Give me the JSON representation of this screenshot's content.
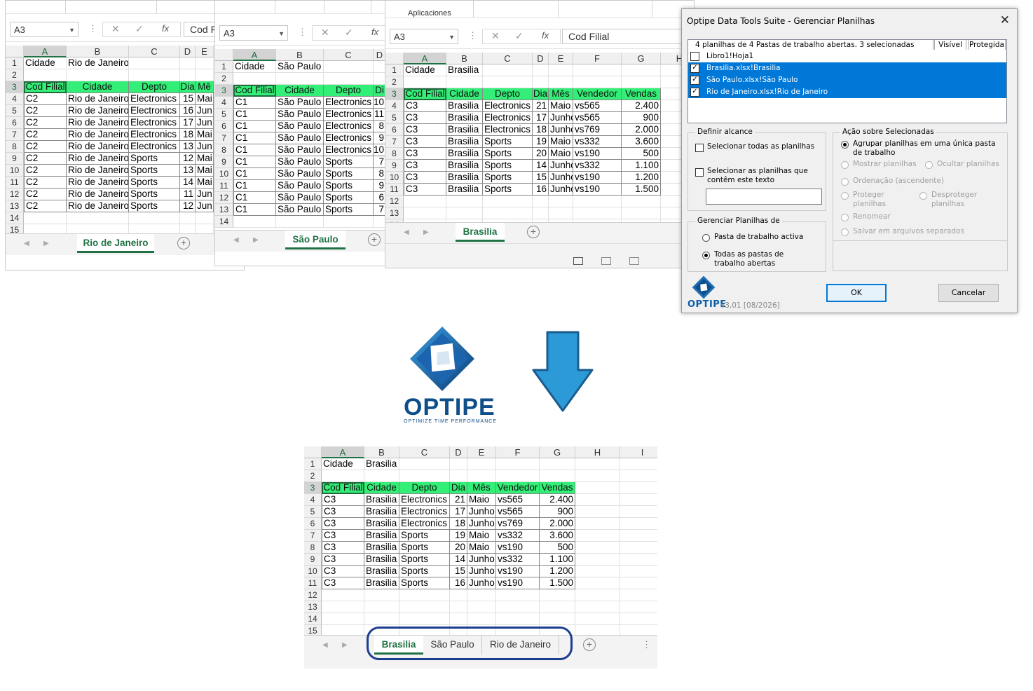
{
  "colors": {
    "header_fill": "#33ee77",
    "excel_green": "#217346",
    "select_blue": "#0078d7",
    "arrow_blue": "#2d9ad8",
    "oval_blue": "#1c3e8e"
  },
  "windows": {
    "rio": {
      "namebox": "A3",
      "formula": "Cod Fi",
      "col_headers": [
        "A",
        "B",
        "C",
        "D",
        "E"
      ],
      "rows": [
        "1",
        "2",
        "3",
        "4",
        "5",
        "6",
        "7",
        "8",
        "9",
        "10",
        "11",
        "12",
        "13",
        "14",
        "15"
      ],
      "r1": [
        "Cidade",
        "Rio de Janeiro"
      ],
      "header": [
        "Cod Filial",
        "Cidade",
        "Depto",
        "Dia",
        "Mê"
      ],
      "data": [
        [
          "C2",
          "Rio de Janeiro",
          "Electronics",
          "15",
          "Mai"
        ],
        [
          "C2",
          "Rio de Janeiro",
          "Electronics",
          "16",
          "Jun"
        ],
        [
          "C2",
          "Rio de Janeiro",
          "Electronics",
          "17",
          "Jun"
        ],
        [
          "C2",
          "Rio de Janeiro",
          "Electronics",
          "18",
          "Mai"
        ],
        [
          "C2",
          "Rio de Janeiro",
          "Electronics",
          "13",
          "Jun"
        ],
        [
          "C2",
          "Rio de Janeiro",
          "Sports",
          "12",
          "Mai"
        ],
        [
          "C2",
          "Rio de Janeiro",
          "Sports",
          "13",
          "Mai"
        ],
        [
          "C2",
          "Rio de Janeiro",
          "Sports",
          "14",
          "Mai"
        ],
        [
          "C2",
          "Rio de Janeiro",
          "Sports",
          "11",
          "Jun"
        ],
        [
          "C2",
          "Rio de Janeiro",
          "Sports",
          "12",
          "Jun"
        ]
      ],
      "tab": "Rio de Janeiro"
    },
    "sp": {
      "namebox": "A3",
      "col_headers": [
        "A",
        "B",
        "C",
        "D"
      ],
      "rows": [
        "1",
        "2",
        "3",
        "4",
        "5",
        "6",
        "7",
        "8",
        "9",
        "10",
        "11",
        "12",
        "13",
        "14"
      ],
      "r1": [
        "Cidade",
        "São Paulo"
      ],
      "header": [
        "Cod Filial",
        "Cidade",
        "Depto",
        "Di"
      ],
      "data": [
        [
          "C1",
          "São Paulo",
          "Electronics",
          "10"
        ],
        [
          "C1",
          "São Paulo",
          "Electronics",
          "11"
        ],
        [
          "C1",
          "São Paulo",
          "Electronics",
          "8"
        ],
        [
          "C1",
          "São Paulo",
          "Electronics",
          "9"
        ],
        [
          "C1",
          "São Paulo",
          "Electronics",
          "10"
        ],
        [
          "C1",
          "São Paulo",
          "Sports",
          "7"
        ],
        [
          "C1",
          "São Paulo",
          "Sports",
          "8"
        ],
        [
          "C1",
          "São Paulo",
          "Sports",
          "9"
        ],
        [
          "C1",
          "São Paulo",
          "Sports",
          "6"
        ],
        [
          "C1",
          "São Paulo",
          "Sports",
          "7"
        ]
      ],
      "tab": "São Paulo"
    },
    "bsb": {
      "ribbon_label": "Aplicaciones",
      "namebox": "A3",
      "formula": "Cod Filial",
      "col_headers": [
        "A",
        "B",
        "C",
        "D",
        "E",
        "F",
        "G",
        "H"
      ],
      "rows": [
        "1",
        "2",
        "3",
        "4",
        "5",
        "6",
        "7",
        "8",
        "9",
        "10",
        "11",
        "12",
        "13",
        "14"
      ],
      "r1": [
        "Cidade",
        "Brasilia"
      ],
      "tab": "Brasilia"
    }
  },
  "brasilia_table": {
    "header": [
      "Cod Filial",
      "Cidade",
      "Depto",
      "Dia",
      "Mês",
      "Vendedor",
      "Vendas"
    ],
    "data": [
      [
        "C3",
        "Brasilia",
        "Electronics",
        "21",
        "Maio",
        "vs565",
        "2.400"
      ],
      [
        "C3",
        "Brasilia",
        "Electronics",
        "17",
        "Junho",
        "vs565",
        "900"
      ],
      [
        "C3",
        "Brasilia",
        "Electronics",
        "18",
        "Junho",
        "vs769",
        "2.000"
      ],
      [
        "C3",
        "Brasilia",
        "Sports",
        "19",
        "Maio",
        "vs332",
        "3.600"
      ],
      [
        "C3",
        "Brasilia",
        "Sports",
        "20",
        "Maio",
        "vs190",
        "500"
      ],
      [
        "C3",
        "Brasilia",
        "Sports",
        "14",
        "Junho",
        "vs332",
        "1.100"
      ],
      [
        "C3",
        "Brasilia",
        "Sports",
        "15",
        "Junho",
        "vs190",
        "1.200"
      ],
      [
        "C3",
        "Brasilia",
        "Sports",
        "16",
        "Junho",
        "vs190",
        "1.500"
      ]
    ]
  },
  "dialog": {
    "title": "Optipe Data Tools Suite - Gerenciar Planilhas",
    "list_header": "4 planilhas de 4 Pastas de trabalho abertas.  3 selecionadas",
    "col_visible": "Visível",
    "col_protected": "Protegida",
    "items": [
      {
        "label": "Libro1!Hoja1",
        "checked": false,
        "selected": false
      },
      {
        "label": "Brasilia.xlsx!Brasilia",
        "checked": true,
        "selected": true
      },
      {
        "label": "São Paulo.xlsx!São Paulo",
        "checked": true,
        "selected": true
      },
      {
        "label": "Rio de Janeiro.xlsx!Rio de Janeiro",
        "checked": true,
        "selected": true
      }
    ],
    "scope_group": "Definir alcance",
    "scope_all": "Selecionar todas as planilhas",
    "scope_text": "Selecionar as planilhas que contêm este texto",
    "action_group": "Ação sobre Selecionadas",
    "act_group": "Agrupar planilhas em uma única pasta de trabalho",
    "act_show": "Mostrar planilhas",
    "act_hide": "Ocultar planilhas",
    "act_sort": "Ordenação (ascendente)",
    "act_protect": "Proteger planilhas",
    "act_unprotect": "Desproteger planilhas",
    "act_rename": "Renomear",
    "act_save": "Salvar em arquivos separados",
    "manage_group": "Gerenciar Planilhas de",
    "manage_active": "Pasta de trabalho activa",
    "manage_all": "Todas as pastas de trabalho abertas",
    "ok": "OK",
    "cancel": "Cancelar",
    "brand": "OPTIPE",
    "version": "v3,01 [08/2026]"
  },
  "logo": {
    "name": "OPTIPE",
    "tagline": "OPTIMIZE TIME PERFORMANCE"
  },
  "result": {
    "col_headers": [
      "A",
      "B",
      "C",
      "D",
      "E",
      "F",
      "G",
      "H",
      "I"
    ],
    "rows": [
      "1",
      "2",
      "3",
      "4",
      "5",
      "6",
      "7",
      "8",
      "9",
      "10",
      "11",
      "12",
      "13",
      "14",
      "15"
    ],
    "r1": [
      "Cidade",
      "Brasilia"
    ],
    "tabs": [
      "Brasilia",
      "São Paulo",
      "Rio de Janeiro"
    ]
  }
}
